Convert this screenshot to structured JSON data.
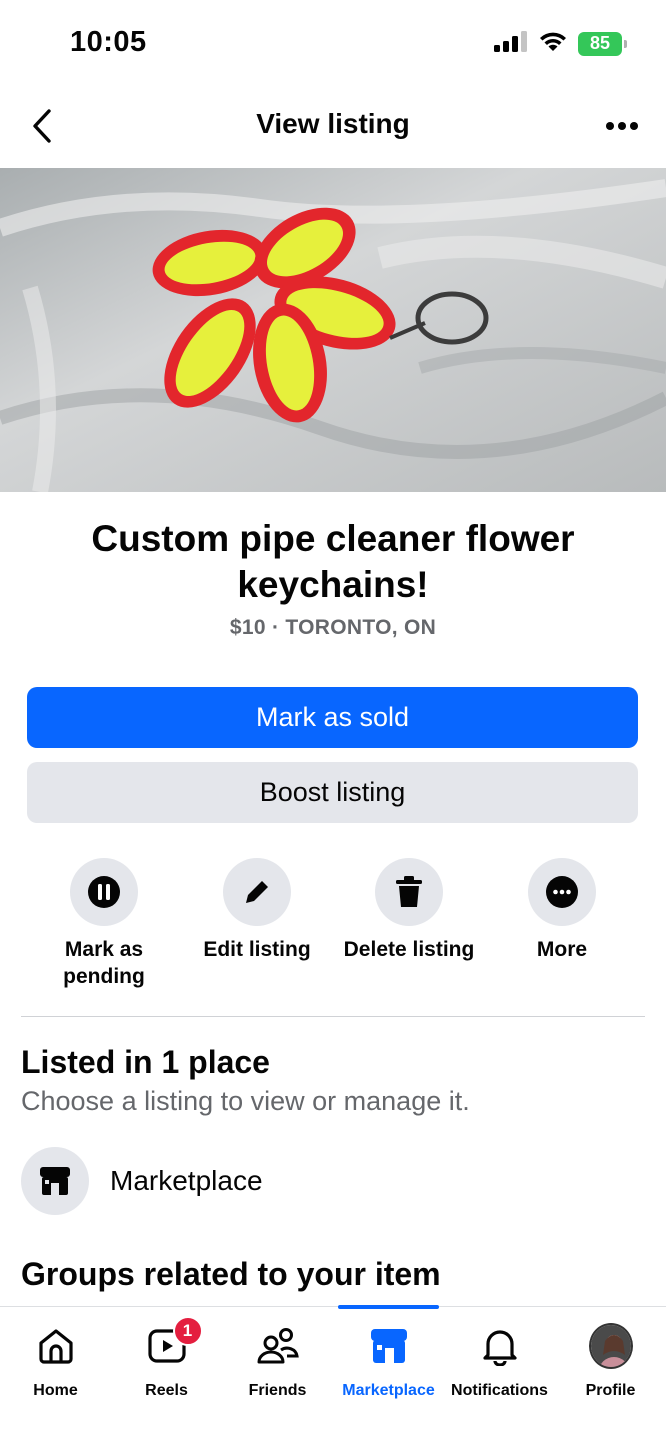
{
  "status_bar": {
    "time": "10:05",
    "battery": "85"
  },
  "header": {
    "title": "View listing",
    "back_icon": "chevron-left-icon",
    "more_icon": "ellipsis-icon"
  },
  "listing": {
    "title": "Custom pipe cleaner flower keychains!",
    "meta": "$10 · TORONTO, ON"
  },
  "buttons": {
    "mark_sold": "Mark as sold",
    "boost": "Boost listing"
  },
  "actions": [
    {
      "label": "Mark as pending",
      "icon": "pause-icon"
    },
    {
      "label": "Edit listing",
      "icon": "pencil-icon"
    },
    {
      "label": "Delete listing",
      "icon": "trash-icon"
    },
    {
      "label": "More",
      "icon": "ellipsis-icon"
    }
  ],
  "listed": {
    "title": "Listed in 1 place",
    "subtitle": "Choose a listing to view or manage it.",
    "place": "Marketplace"
  },
  "groups": {
    "title": "Groups related to your item"
  },
  "tabbar": {
    "tabs": [
      {
        "label": "Home",
        "icon": "home-icon"
      },
      {
        "label": "Reels",
        "icon": "reels-icon",
        "badge": "1"
      },
      {
        "label": "Friends",
        "icon": "friends-icon"
      },
      {
        "label": "Marketplace",
        "icon": "marketplace-icon"
      },
      {
        "label": "Notifications",
        "icon": "bell-icon"
      },
      {
        "label": "Profile",
        "icon": "avatar"
      }
    ],
    "active_tab": "Marketplace"
  },
  "colors": {
    "accent": "#0866ff",
    "secondary_bg": "#e4e6eb",
    "muted_text": "#65676b",
    "badge": "#e41e3f",
    "battery": "#34c759"
  }
}
